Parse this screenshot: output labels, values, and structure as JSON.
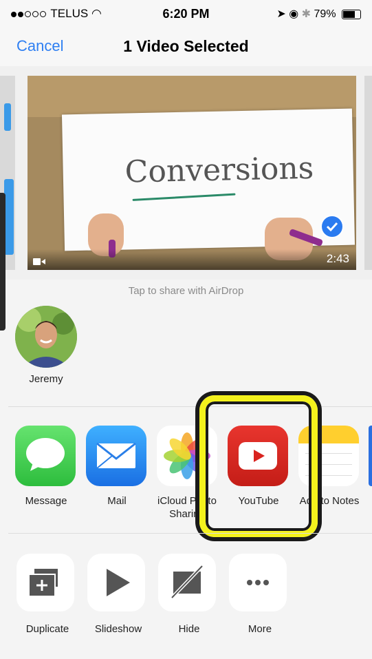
{
  "status_bar": {
    "carrier": "TELUS",
    "time": "6:20 PM",
    "battery": "79%",
    "battery_level": 0.79
  },
  "nav": {
    "cancel_label": "Cancel",
    "title": "1 Video Selected"
  },
  "preview": {
    "board_text": "Conversions",
    "duration": "2:43",
    "selected": true
  },
  "airdrop": {
    "hint": "Tap to share with AirDrop",
    "contacts": [
      {
        "name": "Jeremy"
      }
    ]
  },
  "share_apps": [
    {
      "label": "Message",
      "icon": "message-icon",
      "color": "#3ecf4f"
    },
    {
      "label": "Mail",
      "icon": "mail-icon",
      "color": "#1f8bf0"
    },
    {
      "label": "iCloud Photo Sharing",
      "icon": "photos-icon",
      "color": "#ffffff"
    },
    {
      "label": "YouTube",
      "icon": "youtube-icon",
      "color": "#d9231f"
    },
    {
      "label": "Add to Notes",
      "icon": "notes-icon",
      "color": "#ffd23a"
    }
  ],
  "actions": [
    {
      "label": "Duplicate",
      "icon": "duplicate-icon"
    },
    {
      "label": "Slideshow",
      "icon": "play-icon"
    },
    {
      "label": "Hide",
      "icon": "hide-icon"
    },
    {
      "label": "More",
      "icon": "more-icon"
    }
  ],
  "highlight_color": "#f4f21d",
  "accent_color": "#2e7ff2"
}
